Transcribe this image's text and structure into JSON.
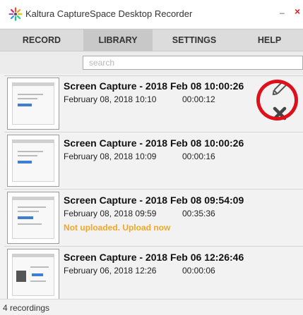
{
  "window": {
    "title": "Kaltura CaptureSpace Desktop Recorder",
    "minimize_glyph": "–",
    "close_glyph": "×"
  },
  "tabs": [
    {
      "label": "RECORD",
      "active": false
    },
    {
      "label": "LIBRARY",
      "active": true
    },
    {
      "label": "SETTINGS",
      "active": false
    },
    {
      "label": "HELP",
      "active": false
    }
  ],
  "search": {
    "placeholder": "search",
    "value": ""
  },
  "recordings": [
    {
      "title": "Screen Capture - 2018 Feb 08 10:00:26",
      "date": "February 08, 2018 10:10",
      "duration": "00:00:12",
      "status": ""
    },
    {
      "title": "Screen Capture - 2018 Feb 08 10:00:26",
      "date": "February 08, 2018 10:09",
      "duration": "00:00:16",
      "status": ""
    },
    {
      "title": "Screen Capture - 2018 Feb 08 09:54:09",
      "date": "February 08, 2018 09:59",
      "duration": "00:35:36",
      "status": "Not uploaded. Upload now"
    },
    {
      "title": "Screen Capture - 2018 Feb 06 12:26:46",
      "date": "February 06, 2018 12:26",
      "duration": "00:00:06",
      "status": ""
    }
  ],
  "actions": {
    "edit_icon": "pencil-icon",
    "delete_icon": "close-x-icon"
  },
  "footer": {
    "count_label": "4 recordings"
  },
  "colors": {
    "status_warning": "#f5a623",
    "highlight": "#e0101a",
    "active_tab": "#c8c8c8"
  }
}
